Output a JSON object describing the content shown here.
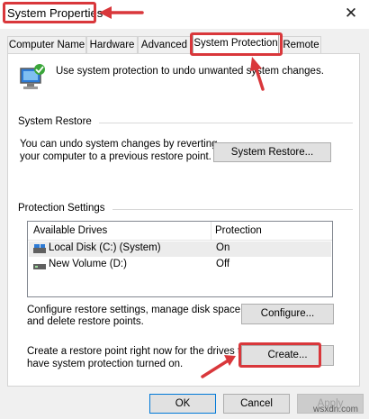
{
  "window": {
    "title": "System Properties",
    "close_glyph": "✕"
  },
  "tabs": [
    {
      "label": "Computer Name"
    },
    {
      "label": "Hardware"
    },
    {
      "label": "Advanced"
    },
    {
      "label": "System Protection"
    },
    {
      "label": "Remote"
    }
  ],
  "intro": {
    "icon": "system-protection-icon",
    "text": "Use system protection to undo unwanted system changes."
  },
  "system_restore": {
    "heading": "System Restore",
    "description_line1": "You can undo system changes by reverting",
    "description_line2": "your computer to a previous restore point.",
    "button": "System Restore..."
  },
  "protection_settings": {
    "heading": "Protection Settings",
    "columns": [
      "Available Drives",
      "Protection"
    ],
    "rows": [
      {
        "drive": "Local Disk (C:) (System)",
        "protection": "On",
        "icon": "system-drive-icon"
      },
      {
        "drive": "New Volume (D:)",
        "protection": "Off",
        "icon": "drive-icon"
      }
    ],
    "configure_line1": "Configure restore settings, manage disk space,",
    "configure_line2": "and delete restore points.",
    "configure_button": "Configure...",
    "create_line1": "Create a restore point right now for the drives that",
    "create_line2": "have system protection turned on.",
    "create_button": "Create..."
  },
  "footer": {
    "ok": "OK",
    "cancel": "Cancel",
    "apply": "Apply"
  },
  "watermark": "wsxdn.com",
  "colors": {
    "highlight": "#d9373b",
    "focus_border": "#0078d7"
  }
}
